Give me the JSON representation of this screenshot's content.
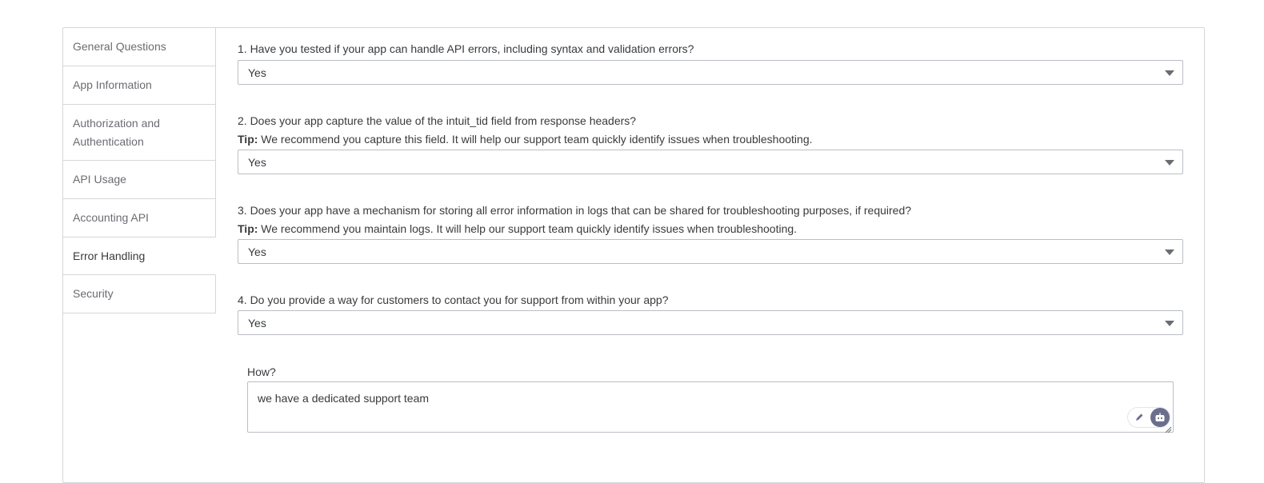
{
  "sidebar": {
    "items": [
      {
        "label": "General Questions"
      },
      {
        "label": "App Information"
      },
      {
        "label": "Authorization and Authentication"
      },
      {
        "label": "API Usage"
      },
      {
        "label": "Accounting API"
      },
      {
        "label": "Error Handling"
      },
      {
        "label": "Security"
      }
    ],
    "active": "Error Handling"
  },
  "questions": [
    {
      "label": "1. Have you tested if your app can handle API errors, including syntax and validation errors?",
      "value": "Yes"
    },
    {
      "label": "2. Does your app capture the value of the intuit_tid field from response headers?",
      "tip_prefix": "Tip:",
      "tip_text": " We recommend you capture this field. It will help our support team quickly identify issues when troubleshooting.",
      "value": "Yes"
    },
    {
      "label": "3. Does your app have a mechanism for storing all error information in logs that can be shared for troubleshooting purposes, if required?",
      "tip_prefix": "Tip:",
      "tip_text": " We recommend you maintain logs. It will help our support team quickly identify issues when troubleshooting.",
      "value": "Yes"
    },
    {
      "label": "4. Do you provide a way for customers to contact you for support from within your app?",
      "value": "Yes"
    }
  ],
  "how": {
    "label": "How?",
    "value": "we have a dedicated support team"
  },
  "icons": {
    "dropdown": "chevron-down-icon",
    "pen": "pen-icon",
    "assistant": "robot-icon",
    "resize": "resize-grip-icon"
  },
  "colors": {
    "text": "#393a3d",
    "muted": "#6b6c72",
    "border": "#d4d7dc",
    "input_border": "#babec5",
    "assistant_bg": "#6c6f8c"
  }
}
